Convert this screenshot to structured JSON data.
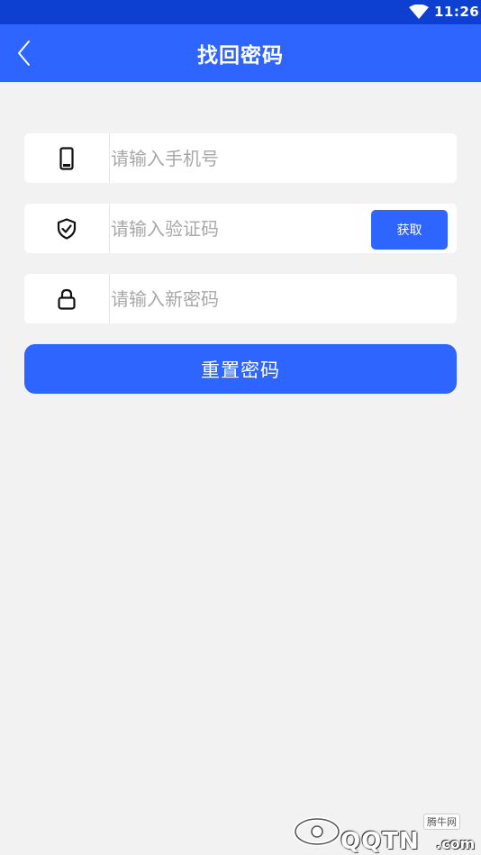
{
  "status_bar": {
    "time": "11:26",
    "wifi_icon": "wifi-icon"
  },
  "app_bar": {
    "title": "找回密码",
    "back_icon": "chevron-left-icon"
  },
  "form": {
    "phone": {
      "icon": "smartphone-icon",
      "placeholder": "请输入手机号",
      "value": ""
    },
    "code": {
      "icon": "shield-check-icon",
      "placeholder": "请输入验证码",
      "value": "",
      "get_code_label": "获取"
    },
    "new_password": {
      "icon": "lock-icon",
      "placeholder": "请输入新密码",
      "value": ""
    },
    "submit_label": "重置密码"
  },
  "watermark": {
    "brand_small": "腾牛网",
    "brand_text": "QQTN",
    "brand_suffix": ".com"
  },
  "colors": {
    "primary": "#2e64ff",
    "status_bar": "#0d3fd1",
    "background": "#f2f2f2"
  }
}
